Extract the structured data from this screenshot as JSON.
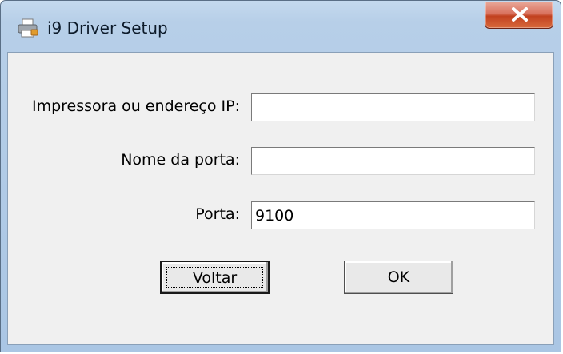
{
  "window": {
    "title": "i9 Driver Setup",
    "icon": "printer-icon"
  },
  "form": {
    "printer_label": "Impressora ou endereço IP:",
    "printer_value": "",
    "port_name_label": "Nome da porta:",
    "port_name_value": "",
    "port_label": "Porta:",
    "port_value": "9100"
  },
  "buttons": {
    "back_label": "Voltar",
    "ok_label": "OK"
  },
  "colors": {
    "close_button": "#c1411f",
    "titlebar": "#b7cfe8",
    "client_bg": "#f0f0f0"
  }
}
